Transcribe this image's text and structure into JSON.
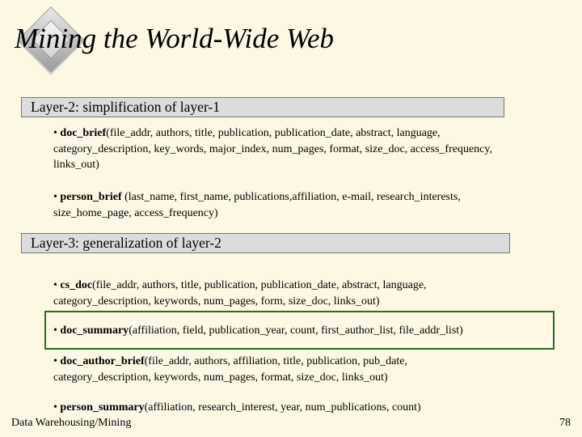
{
  "slide": {
    "title": "Mining the World-Wide Web",
    "layer2_heading": "Layer-2: simplification of layer-1",
    "layer3_heading": "Layer-3: generalization of layer-2",
    "bullets": [
      {
        "name": "doc_brief",
        "lines": [
          "(file_addr, authors, title, publication, publication_date, abstract, language,",
          "category_description, key_words, major_index, num_pages, format, size_doc, access_frequency,",
          "links_out)"
        ]
      },
      {
        "name": "person_brief",
        "lines": [
          " (last_name, first_name, publications,affiliation, e-mail, research_interests,",
          "size_home_page, access_frequency)"
        ]
      },
      {
        "name": "cs_doc",
        "lines": [
          "(file_addr, authors, title, publication, publication_date, abstract, language,",
          "category_description, keywords, num_pages, form, size_doc, links_out)"
        ]
      },
      {
        "name": "doc_summary",
        "lines": [
          "(affiliation, field, publication_year, count, first_author_list, file_addr_list)"
        ]
      },
      {
        "name": "doc_author_brief",
        "lines": [
          "(file_addr, authors, affiliation, title, publication, pub_date,",
          "category_description, keywords, num_pages, format, size_doc, links_out)"
        ]
      },
      {
        "name": "person_summary",
        "lines": [
          "(affiliation, research_interest, year, num_publications, count)"
        ]
      }
    ]
  },
  "footer": {
    "left": "Data Warehousing/Mining",
    "page_number": "78"
  }
}
